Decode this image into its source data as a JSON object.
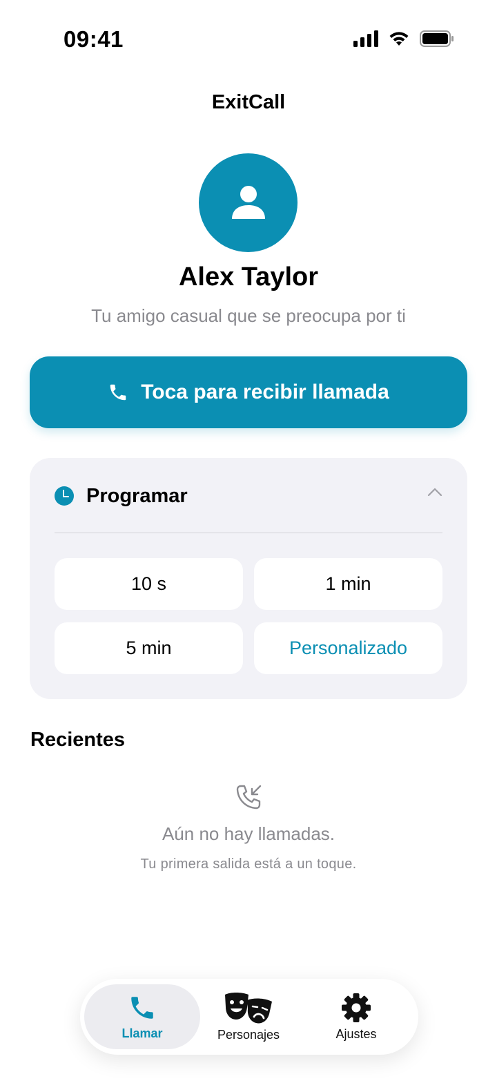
{
  "status_bar": {
    "time": "09:41"
  },
  "app": {
    "title": "ExitCall"
  },
  "caller": {
    "name": "Alex Taylor",
    "description": "Tu amigo casual que se preocupa por ti"
  },
  "call_button": {
    "label": "Toca para recibir llamada",
    "icon": "phone-icon"
  },
  "schedule": {
    "title": "Programar",
    "icon": "clock-icon",
    "options": [
      "10 s",
      "1 min",
      "5 min",
      "Personalizado"
    ]
  },
  "recents": {
    "title": "Recientes",
    "empty_title": "Aún no hay llamadas.",
    "empty_subtitle": "Tu primera salida está a un toque."
  },
  "tabs": [
    {
      "label": "Llamar",
      "icon": "phone-icon",
      "active": true
    },
    {
      "label": "Personajes",
      "icon": "theater-masks-icon",
      "active": false
    },
    {
      "label": "Ajustes",
      "icon": "gear-icon",
      "active": false
    }
  ],
  "colors": {
    "accent": "#0b8fb3",
    "card_bg": "#f2f2f7",
    "secondary_text": "#8a8a8f"
  }
}
